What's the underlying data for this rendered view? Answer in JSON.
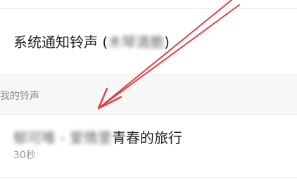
{
  "system_row": {
    "title": "系统通知铃声 (",
    "value_blurred": "木琴清脆",
    "close": ")"
  },
  "section": {
    "label": "我的铃声"
  },
  "my_ringtone": {
    "blurred_prefix": "郁可唯 - 爱情里",
    "title": "青春的旅行",
    "duration": "30秒"
  },
  "annotation": {
    "color": "#e1404a"
  }
}
